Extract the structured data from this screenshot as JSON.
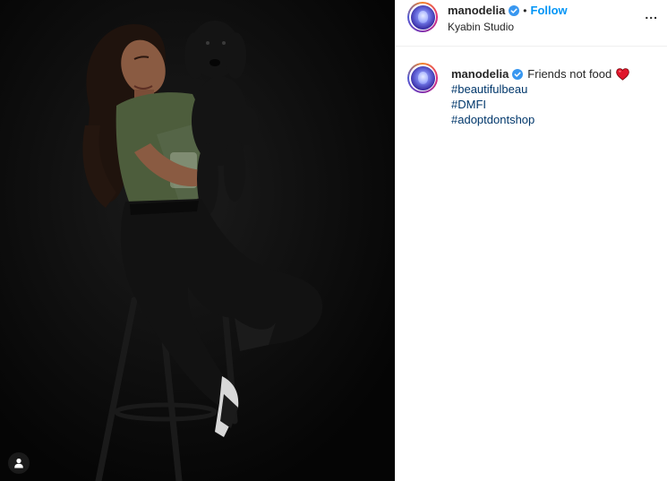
{
  "post": {
    "username": "manodelia",
    "follow_label": "Follow",
    "location": "Kyabin Studio",
    "more_label": "...",
    "separator": "•"
  },
  "caption": {
    "username": "manodelia",
    "text": "Friends not food",
    "hashtags": [
      "#beautifulbeau",
      "#DMFI",
      "#adoptdontshop"
    ]
  },
  "icons": {
    "verified": "verified-badge-icon",
    "heart": "red-heart-icon",
    "user_tag": "user-tag-icon",
    "more": "more-options-icon"
  },
  "colors": {
    "follow": "#0095f6",
    "verified": "#3897f0",
    "hashtag": "#00376b",
    "heart": "#e0142a",
    "photo_background": "#0c0c0c"
  }
}
